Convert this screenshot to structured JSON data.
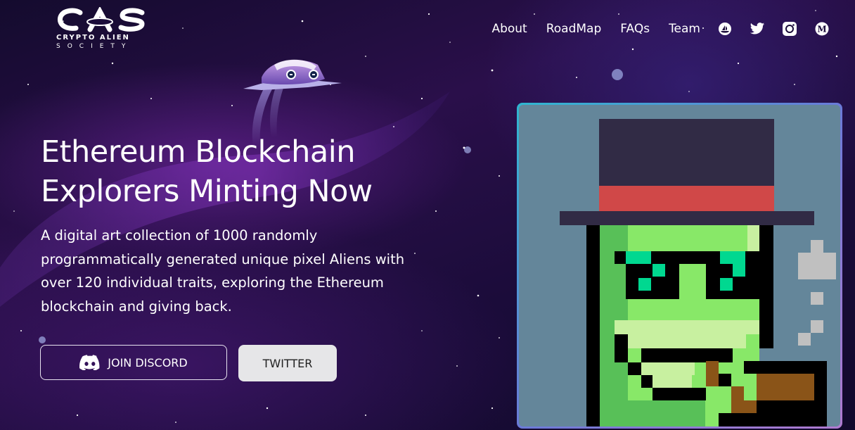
{
  "brand": {
    "logo_text": "CAS",
    "line1": "CRYPTO ALIEN",
    "line2": "SOCIETY"
  },
  "nav": {
    "items": [
      {
        "label": "About"
      },
      {
        "label": "RoadMap"
      },
      {
        "label": "FAQs"
      },
      {
        "label": "Team"
      }
    ],
    "socials": [
      {
        "icon": "opensea-icon"
      },
      {
        "icon": "twitter-icon"
      },
      {
        "icon": "instagram-icon"
      },
      {
        "icon": "medium-icon"
      }
    ]
  },
  "hero": {
    "headline_line1": "Ethereum Blockchain",
    "headline_line2": "Explorers Minting Now",
    "subtitle": "A digital art collection of 1000 randomly programmatically generated unique pixel Aliens with over 120 individual traits, exploring the Ethereum blockchain and giving back.",
    "discord_button": "JOIN DISCORD",
    "twitter_button": "TWITTER"
  },
  "colors": {
    "background": "#1b0c3a",
    "nft_bg": "#64869a",
    "alien_green": "#88e868",
    "hat_band": "#d04848",
    "button_light": "#e6e6e8"
  }
}
